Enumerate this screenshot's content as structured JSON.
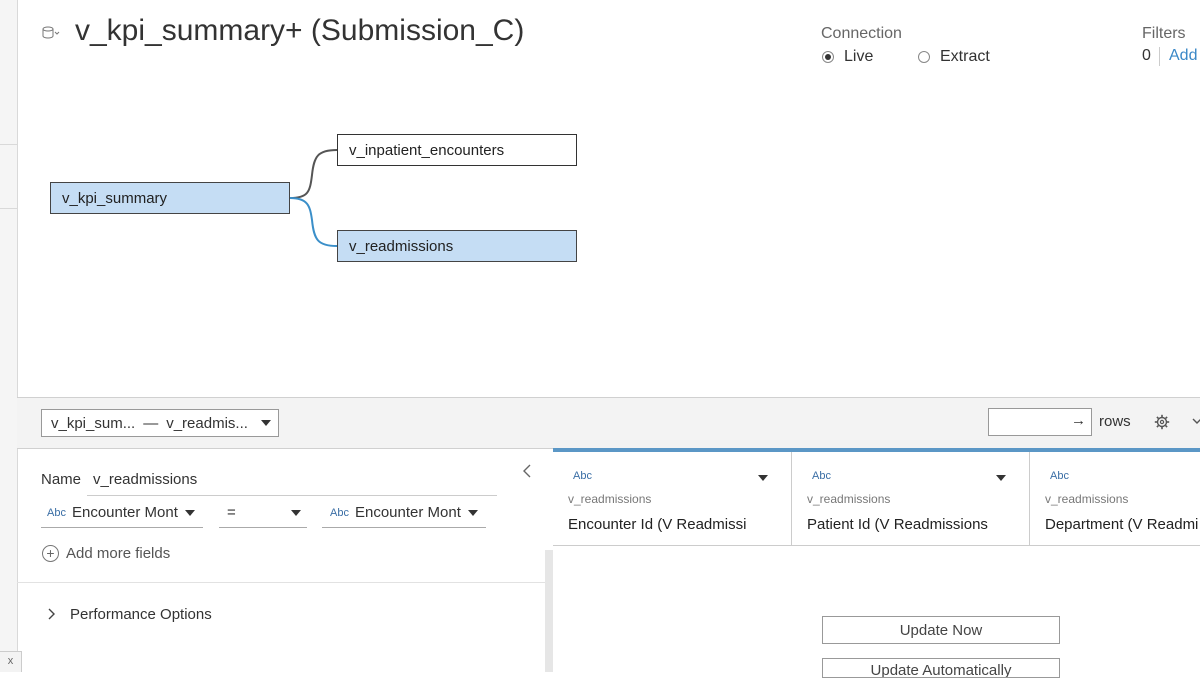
{
  "header": {
    "title": "v_kpi_summary+ (Submission_C)",
    "datasource_icon": "database-icon",
    "connection": {
      "label": "Connection",
      "options": [
        "Live",
        "Extract"
      ],
      "selected": "Live"
    },
    "filters": {
      "label": "Filters",
      "count": "0",
      "add_label": "Add"
    }
  },
  "canvas": {
    "root_table": "v_kpi_summary",
    "joined_tables": [
      "v_inpatient_encounters",
      "v_readmissions"
    ],
    "selected_table": "v_readmissions",
    "link_colors": {
      "unselected": "#555555",
      "selected": "#3b8fc9"
    }
  },
  "toolbar": {
    "join_selector": {
      "left": "v_kpi_sum...",
      "connector": "—",
      "right": "v_readmis..."
    },
    "rows_arrow": "→",
    "rows_label": "rows"
  },
  "relationship_panel": {
    "name_label": "Name",
    "name_value": "v_readmissions",
    "clause": {
      "left_type": "Abc",
      "left_field": "Encounter Mont",
      "operator": "=",
      "right_type": "Abc",
      "right_field": "Encounter Mont"
    },
    "add_more_label": "Add more fields",
    "performance_label": "Performance Options",
    "collapse_icon": "chevron-left-icon"
  },
  "grid": {
    "columns": [
      {
        "type": "Abc",
        "source": "v_readmissions",
        "name": "Encounter Id (V Readmissi"
      },
      {
        "type": "Abc",
        "source": "v_readmissions",
        "name": "Patient Id (V Readmissions"
      },
      {
        "type": "Abc",
        "source": "v_readmissions",
        "name": "Department (V Readmi"
      }
    ],
    "accent_color": "#5b97c6",
    "update_now_label": "Update Now",
    "update_auto_label": "Update Automatically"
  },
  "corner_close_label": "x"
}
